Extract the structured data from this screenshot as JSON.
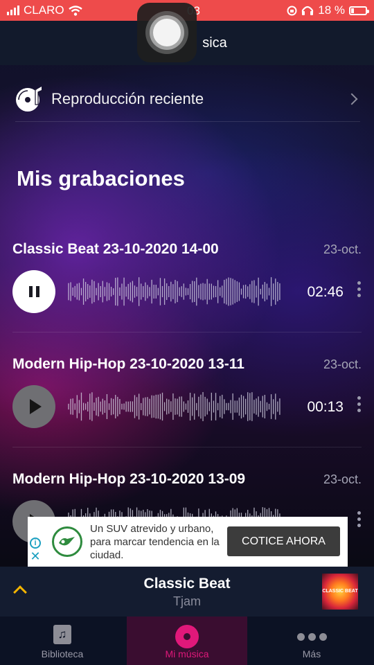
{
  "status_bar": {
    "carrier": "CLARO",
    "time": "03",
    "battery": "18 %"
  },
  "header": {
    "title": "sica"
  },
  "recent": {
    "label": "Reproducción reciente"
  },
  "section_title": "Mis grabaciones",
  "recordings": [
    {
      "title": "Classic Beat 23-10-2020 14-00",
      "date": "23-oct.",
      "duration": "02:46",
      "state": "playing"
    },
    {
      "title": "Modern Hip-Hop 23-10-2020 13-11",
      "date": "23-oct.",
      "duration": "00:13",
      "state": "idle"
    },
    {
      "title": "Modern Hip-Hop 23-10-2020 13-09",
      "date": "23-oct.",
      "duration": "",
      "state": "idle"
    }
  ],
  "ad": {
    "text": "Un SUV atrevido y urbano, para marcar tendencia en la ciudad.",
    "cta": "COTICE AHORA",
    "info_glyph": "i",
    "close_glyph": "✕"
  },
  "now_playing": {
    "title": "Classic Beat",
    "artist": "Tjam",
    "art_text": "CLASSIC BEAT"
  },
  "tabs": [
    {
      "label": "Biblioteca",
      "active": false
    },
    {
      "label": "Mi música",
      "active": true
    },
    {
      "label": "Más",
      "active": false
    }
  ],
  "colors": {
    "accent": "#e0187a",
    "status_bar": "#ee4b4b",
    "now_playing_chevron": "#f3b400"
  }
}
